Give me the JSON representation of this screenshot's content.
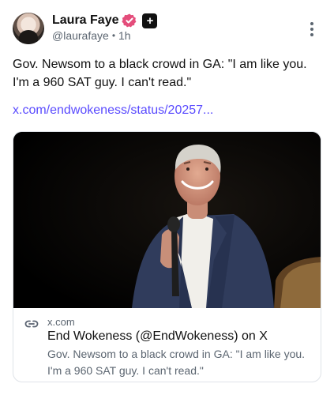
{
  "author": {
    "display_name": "Laura Faye",
    "handle": "@laurafaye",
    "separator": "•",
    "time": "1h",
    "verified_icon": "verified-badge-icon",
    "plus_icon": "plus-badge-icon",
    "plus_label": "+",
    "avatar_icon": "avatar"
  },
  "post": {
    "text": "Gov. Newsom to a black crowd in GA: \"I am like you. I'm a 960 SAT guy. I can't read.\"",
    "link": "x.com/endwokeness/status/20257..."
  },
  "link_card": {
    "domain": "x.com",
    "title": "End Wokeness (@EndWokeness) on X",
    "description": "Gov. Newsom to a black crowd in GA: \"I am like you. I'm a 960 SAT guy. I can't read.\""
  },
  "colors": {
    "link": "#5a4bff",
    "verified": "#e44d7b",
    "muted_text": "#5b6570"
  }
}
